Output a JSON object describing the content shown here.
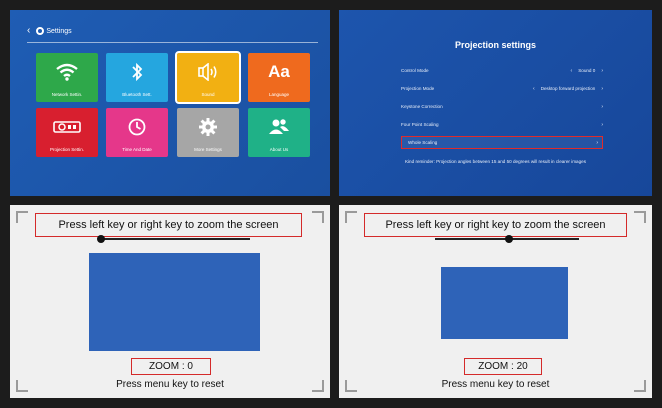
{
  "settings_menu": {
    "title": "Settings",
    "tiles": [
      {
        "label": "Network Settin.",
        "icon": "wifi-icon",
        "color": "#2ea84a"
      },
      {
        "label": "Bluetooth Sett.",
        "icon": "bluetooth-icon",
        "color": "#25a6df"
      },
      {
        "label": "Sound",
        "icon": "speaker-icon",
        "color": "#f2b012"
      },
      {
        "label": "Language",
        "icon": "text-aa-icon",
        "color": "#ef6a1e"
      },
      {
        "label": "Projection Settin.",
        "icon": "projector-icon",
        "color": "#d81f2f"
      },
      {
        "label": "Time And Date",
        "icon": "clock-icon",
        "color": "#e5378a"
      },
      {
        "label": "More Settings",
        "icon": "gear-icon",
        "color": "#a6a6a6"
      },
      {
        "label": "About Us",
        "icon": "users-icon",
        "color": "#1fb187"
      }
    ]
  },
  "projection_settings": {
    "title": "Projection settings",
    "rows": [
      {
        "label": "Control Mode",
        "value": "Sound 0"
      },
      {
        "label": "Projection Mode",
        "value": "Desktop forward projection"
      },
      {
        "label": "Keystone Correction",
        "value": ""
      },
      {
        "label": "Four Point Scaling",
        "value": ""
      },
      {
        "label": "Whole Scaling",
        "value": ""
      }
    ],
    "note": "Kind reminder: Projection angles between 15 and 50 degrees will result in clearer images"
  },
  "zoom_screens": [
    {
      "prompt": "Press left key or right key to zoom the screen",
      "zoom_label": "ZOOM : 0",
      "zoom_value": 0,
      "reset_hint": "Press menu key to reset"
    },
    {
      "prompt": "Press left key or right key to zoom the screen",
      "zoom_label": "ZOOM : 20",
      "zoom_value": 20,
      "reset_hint": "Press menu key to reset"
    }
  ],
  "colors": {
    "menu_bg": "#1f5db4",
    "highlight": "#e02b2b",
    "preview": "#2e63b8"
  }
}
